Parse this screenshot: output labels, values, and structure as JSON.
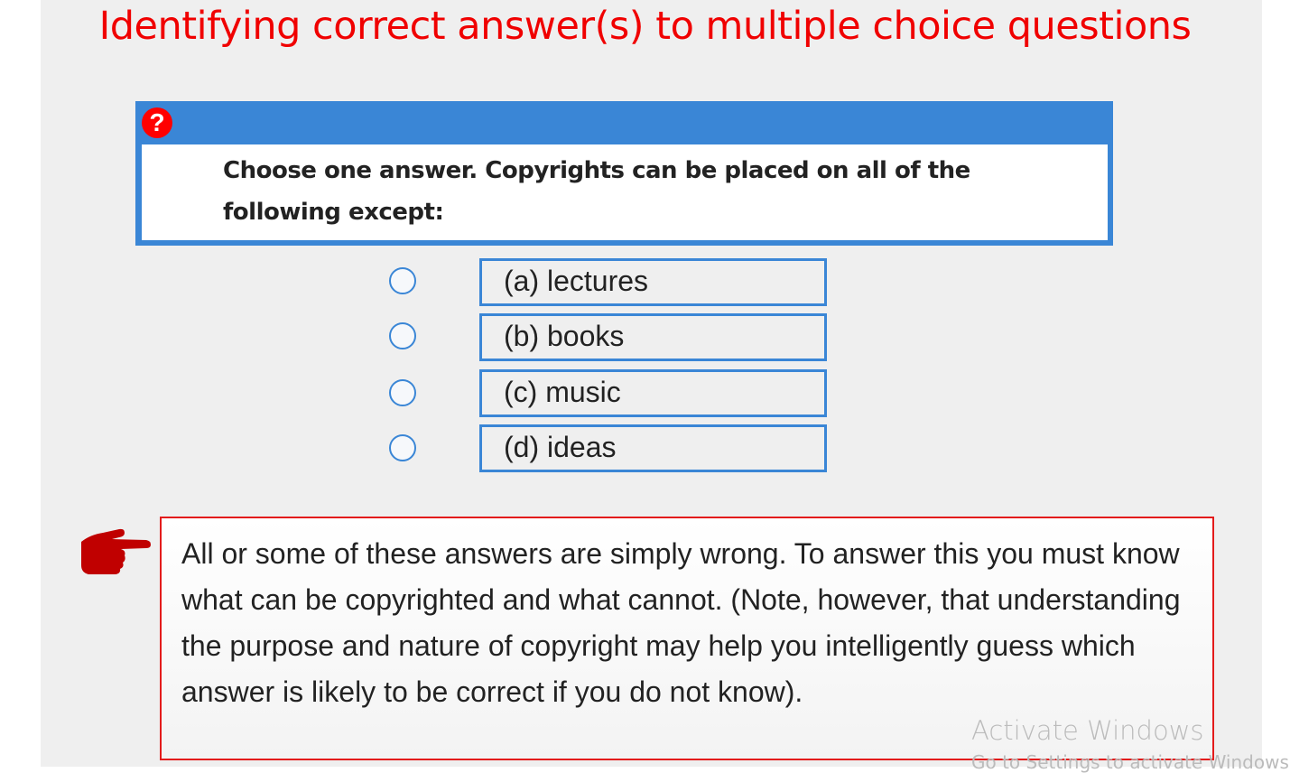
{
  "title": "Identifying correct answer(s) to multiple choice questions",
  "question": {
    "icon": "question-circle-icon",
    "text": "Choose one answer. Copyrights can be placed on all of the following except:"
  },
  "options": [
    {
      "label": "(a) lectures",
      "selected": false
    },
    {
      "label": "(b) books",
      "selected": false
    },
    {
      "label": "(c) music",
      "selected": false
    },
    {
      "label": "(d) ideas",
      "selected": false
    }
  ],
  "note": {
    "icon": "pointing-hand-icon",
    "text": "All or some of these answers are simply wrong. To answer this you must know what can be copyrighted and what cannot. (Note, however, that understanding the purpose and nature of copyright may help you intelligently guess which answer is likely to be correct if you do not know)."
  },
  "watermark": {
    "line1": "Activate Windows",
    "line2": "Go to Settings to activate Windows"
  },
  "colors": {
    "title": "#f00000",
    "accent": "#3a86d6",
    "note_border": "#e31b1b",
    "hand": "#c00000"
  }
}
